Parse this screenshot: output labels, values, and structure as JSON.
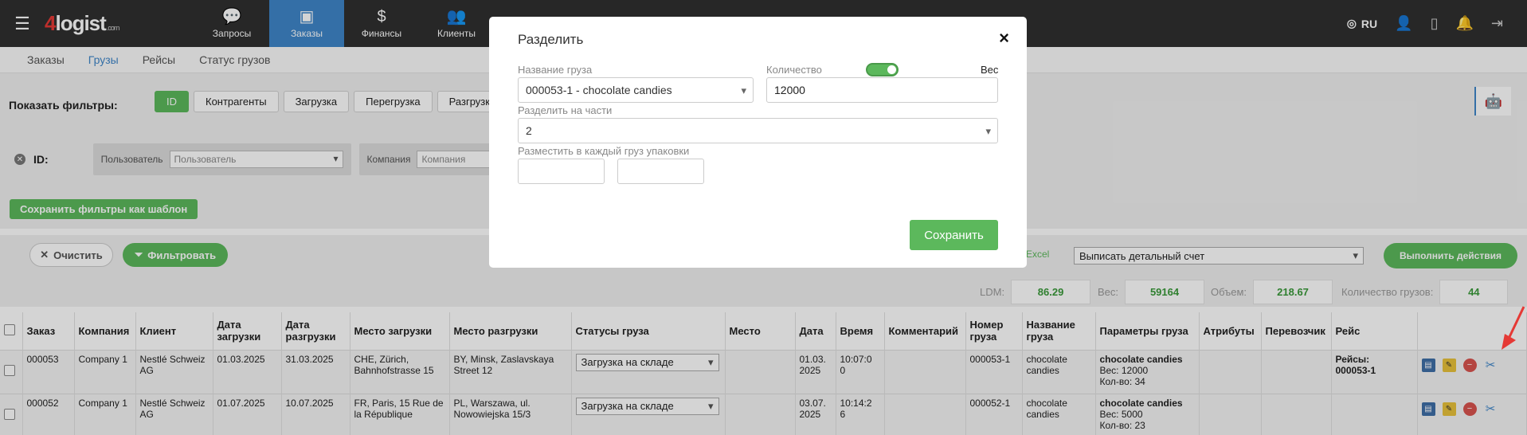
{
  "logo": {
    "prefix": "4",
    "name": "logist",
    "domain": ".com"
  },
  "nav": [
    {
      "label": "Запросы",
      "icon": "speech-bubble-icon"
    },
    {
      "label": "Заказы",
      "icon": "package-icon"
    },
    {
      "label": "Финансы",
      "icon": "money-bag-icon"
    },
    {
      "label": "Клиенты",
      "icon": "users-icon"
    }
  ],
  "top_right": {
    "language": "RU"
  },
  "subnav": [
    "Заказы",
    "Грузы",
    "Рейсы",
    "Статус грузов"
  ],
  "filters": {
    "label": "Показать фильтры:",
    "chips": [
      "ID",
      "Контрагенты",
      "Загрузка",
      "Перегрузка",
      "Разгрузка"
    ],
    "id_label": "ID:",
    "user_label": "Пользователь",
    "user_placeholder": "Пользователь",
    "company_label": "Компания",
    "company_placeholder": "Компания",
    "save_template": "Сохранить фильтры как шаблон"
  },
  "actions": {
    "clear": "Очистить",
    "filter": "Фильтровать",
    "excel": "Excel",
    "bulk_action": "Выписать детальный счет",
    "run": "Выполнить действия"
  },
  "summary": {
    "ldm_label": "LDM:",
    "ldm_value": "86.29",
    "weight_label": "Вес:",
    "weight_value": "59164",
    "volume_label": "Объем:",
    "volume_value": "218.67",
    "count_label": "Количество грузов:",
    "count_value": "44"
  },
  "table": {
    "headers": [
      "Заказ",
      "Компания",
      "Клиент",
      "Дата загрузки",
      "Дата разгрузки",
      "Место загрузки",
      "Место разгрузки",
      "Статусы груза",
      "Место",
      "Дата",
      "Время",
      "Комментарий",
      "Номер груза",
      "Название груза",
      "Параметры груза",
      "Атрибуты",
      "Перевозчик",
      "Рейс"
    ],
    "rows": [
      {
        "order": "000053",
        "company": "Company 1",
        "client": "Nestlé Schweiz AG",
        "load_date": "01.03.2025",
        "unload_date": "31.03.2025",
        "load_place": "CHE, Zürich, Bahnhofstrasse 15",
        "unload_place": "BY, Minsk, Zaslavskaya Street 12",
        "status": "Загрузка на складе",
        "place": "",
        "date": "01.03. 2025",
        "time": "10:07:0 0",
        "comment": "",
        "cargo_no": "000053-1",
        "cargo_name": "chocolate candies",
        "params_title": "chocolate candies",
        "params_weight": "Вес: 12000",
        "params_qty": "Кол-во: 34",
        "attrs": "",
        "carrier": "",
        "trip_label": "Рейсы:",
        "trip_value": "000053-1"
      },
      {
        "order": "000052",
        "company": "Company 1",
        "client": "Nestlé Schweiz AG",
        "load_date": "01.07.2025",
        "unload_date": "10.07.2025",
        "load_place": "FR, Paris, 15 Rue de la République",
        "unload_place": "PL, Warszawa, ul. Nowowiejska 15/3",
        "status": "Загрузка на складе",
        "place": "",
        "date": "03.07. 2025",
        "time": "10:14:2 6",
        "comment": "",
        "cargo_no": "000052-1",
        "cargo_name": "chocolate candies",
        "params_title": "chocolate candies",
        "params_weight": "Вес: 5000",
        "params_qty": "Кол-во: 23",
        "attrs": "",
        "carrier": "",
        "trip_label": "",
        "trip_value": ""
      }
    ]
  },
  "modal": {
    "title": "Разделить",
    "close": "×",
    "cargo_name_label": "Название груза",
    "cargo_name_value": "000053-1 - chocolate candies",
    "quantity_label": "Количество",
    "weight_label": "Вес",
    "quantity_value": "12000",
    "toggle_on": true,
    "parts_label": "Разделить на части",
    "parts_value": "2",
    "packs_label": "Разместить в каждый груз упаковки",
    "pack_1": "",
    "pack_2": "",
    "save": "Сохранить"
  },
  "colors": {
    "accent": "#3f86c9",
    "green": "#5cb85c",
    "topbar": "#2f2f2f",
    "alert_arrow": "#e53935"
  }
}
